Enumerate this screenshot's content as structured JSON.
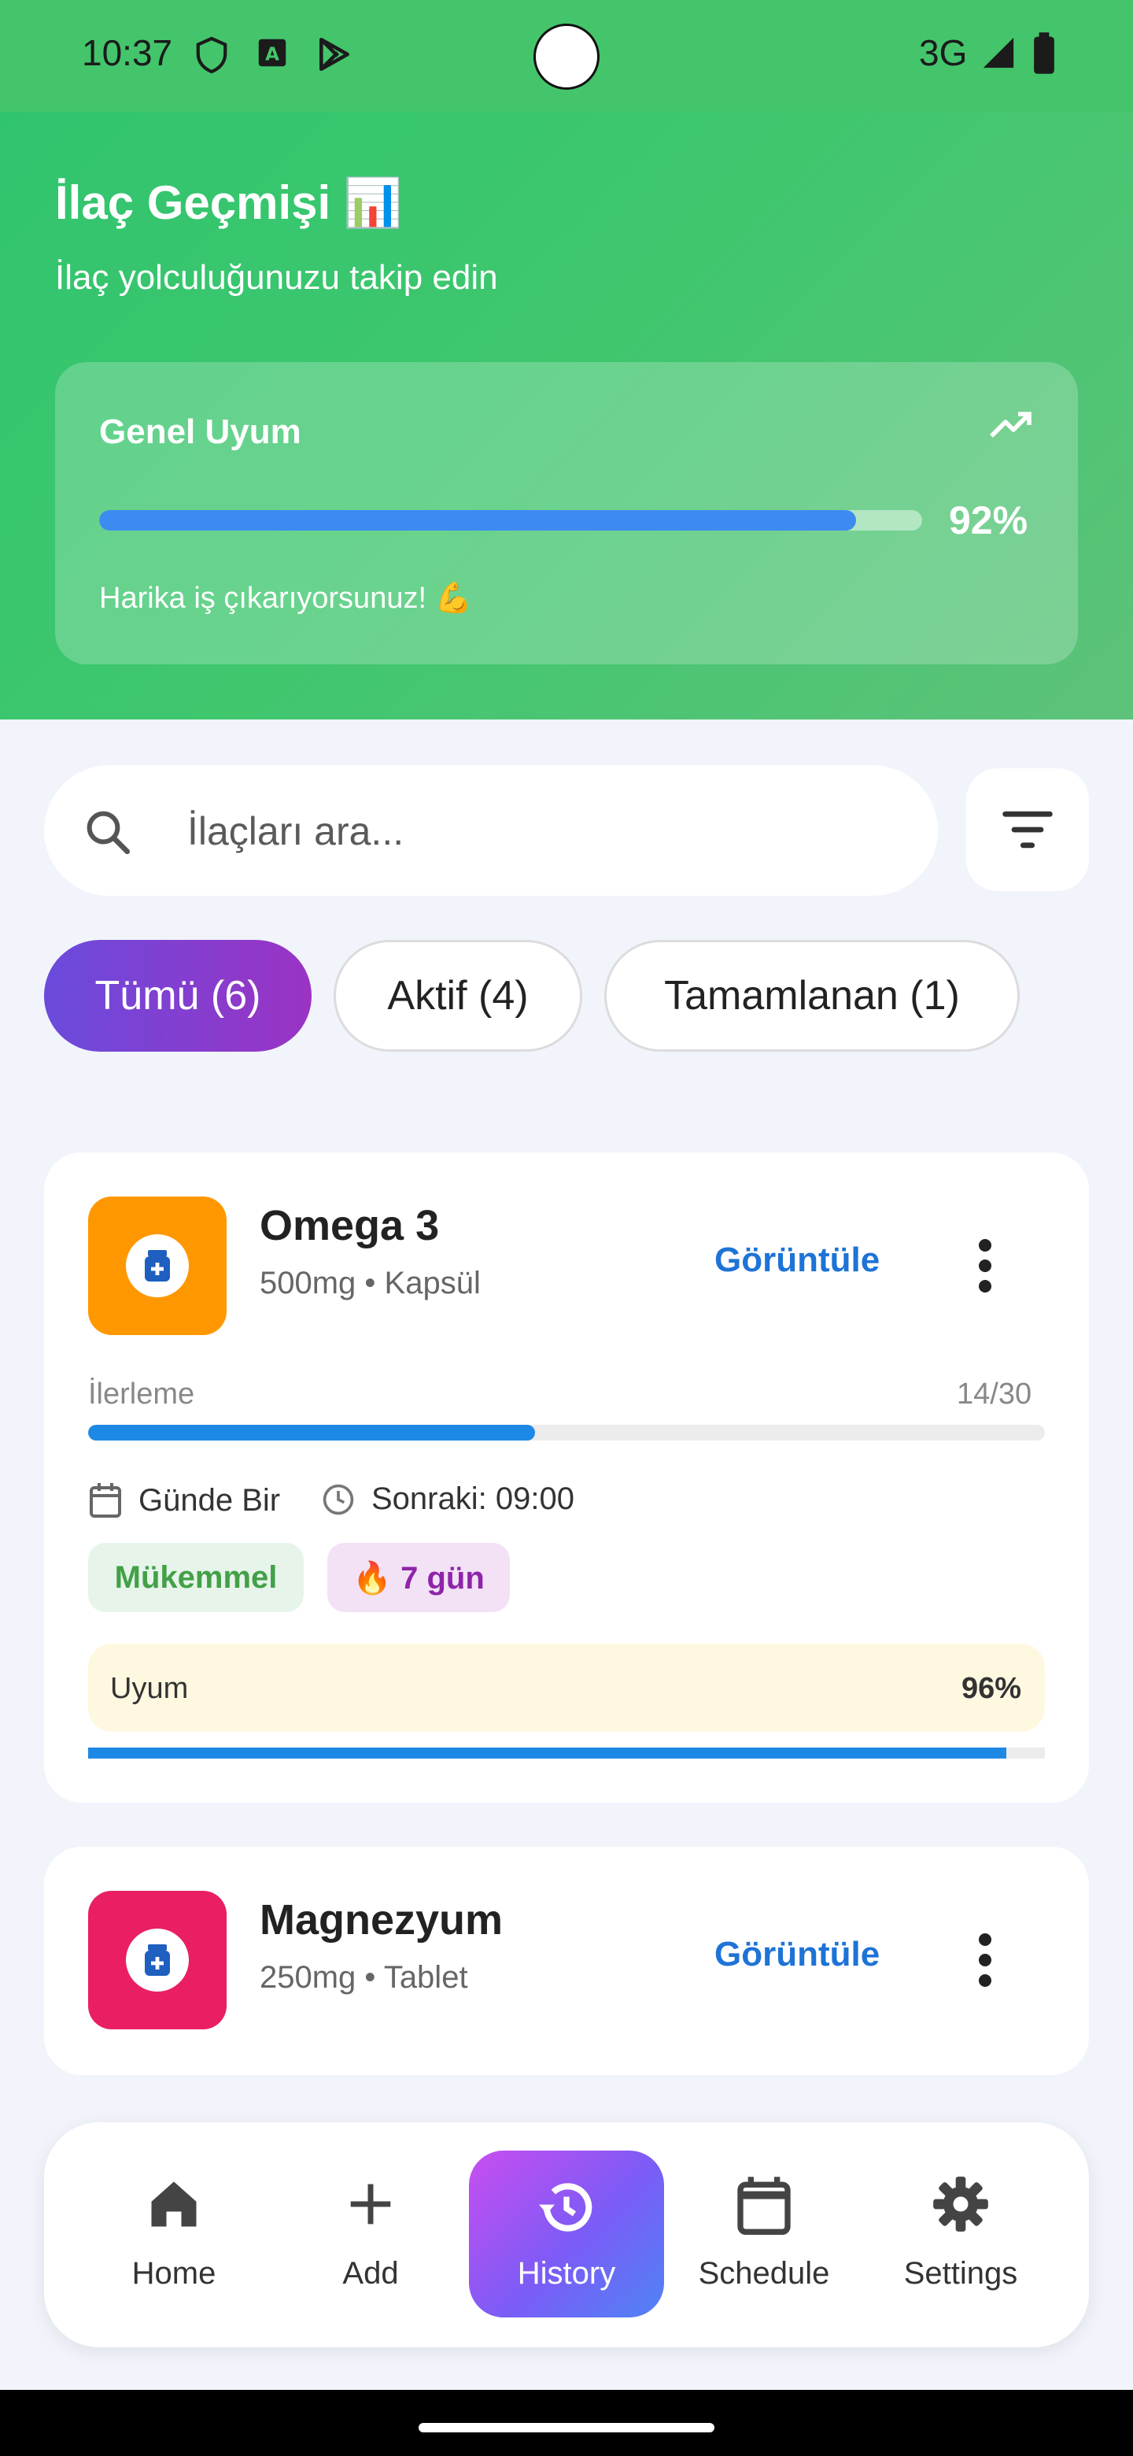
{
  "status_bar": {
    "time": "10:37",
    "network": "3G"
  },
  "header": {
    "title": "İlaç Geçmişi 📊",
    "subtitle": "İlaç yolculuğunuzu takip edin",
    "overall": {
      "title": "Genel Uyum",
      "percent_label": "92%",
      "percent": 92,
      "message": "Harika iş çıkarıyorsunuz! 💪"
    }
  },
  "search": {
    "placeholder": "İlaçları ara..."
  },
  "filters": [
    {
      "label": "Tümü (6)",
      "selected": true
    },
    {
      "label": "Aktif (4)",
      "selected": false
    },
    {
      "label": "Tamamlanan (1)",
      "selected": false
    }
  ],
  "medications": [
    {
      "name": "Omega 3",
      "dose": "500mg • Kapsül",
      "icon_color": "#ff9800",
      "view_label": "Görüntüle",
      "progress_label": "İlerleme",
      "progress_count": "14/30",
      "progress": 0.4667,
      "frequency": "Günde Bir",
      "next_dose": "Sonraki: 09:00",
      "status_badge": "Mükemmel",
      "streak_badge": "🔥 7 gün",
      "adherence_label": "Uyum",
      "adherence_pct": "96%",
      "adherence": 0.96
    },
    {
      "name": "Magnezyum",
      "dose": "250mg • Tablet",
      "icon_color": "#e91e63",
      "view_label": "Görüntüle"
    }
  ],
  "bottom_nav": {
    "items": [
      {
        "label": "Home",
        "icon": "home-icon"
      },
      {
        "label": "Add",
        "icon": "plus-icon"
      },
      {
        "label": "History",
        "icon": "history-icon",
        "active": true
      },
      {
        "label": "Schedule",
        "icon": "calendar-icon"
      },
      {
        "label": "Settings",
        "icon": "gear-icon"
      }
    ]
  }
}
